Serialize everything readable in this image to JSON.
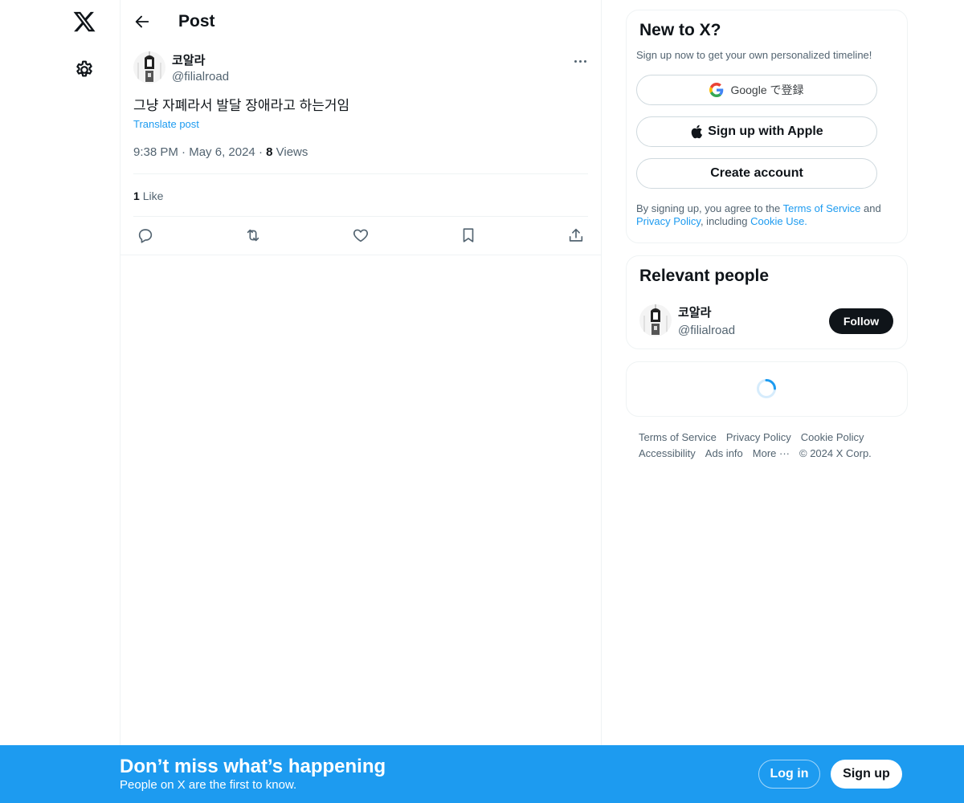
{
  "header": {
    "title": "Post"
  },
  "post": {
    "author_name": "코알라",
    "author_handle": "@filialroad",
    "text": "그냥 자폐라서 발달 장애라고 하는거임",
    "translate_label": "Translate post",
    "time": "9:38 PM",
    "date": "May 6, 2024",
    "views_count": "8",
    "views_label": "Views",
    "likes_count": "1",
    "likes_label": "Like"
  },
  "signup_card": {
    "title": "New to X?",
    "subtitle": "Sign up now to get your own personalized timeline!",
    "google_label": "Google で登録",
    "apple_label": "Sign up with Apple",
    "create_label": "Create account",
    "legal_prefix": "By signing up, you agree to the ",
    "terms_link": "Terms of Service",
    "legal_and": " and ",
    "privacy_link": "Privacy Policy",
    "legal_including": ", including ",
    "cookie_link": "Cookie Use."
  },
  "relevant": {
    "title": "Relevant people",
    "name": "코알라",
    "handle": "@filialroad",
    "follow_label": "Follow"
  },
  "footer": {
    "terms": "Terms of Service",
    "privacy": "Privacy Policy",
    "cookie": "Cookie Policy",
    "accessibility": "Accessibility",
    "ads": "Ads info",
    "more": "More ···",
    "copyright": "© 2024 X Corp."
  },
  "banner": {
    "title": "Don’t miss what’s happening",
    "subtitle": "People on X are the first to know.",
    "login_label": "Log in",
    "signup_label": "Sign up"
  },
  "icons": {
    "logo": "x-logo-icon",
    "settings": "gear-icon",
    "back": "arrow-left-icon",
    "more": "more-dots-icon",
    "reply": "reply-icon",
    "repost": "repost-icon",
    "like": "heart-icon",
    "bookmark": "bookmark-icon",
    "share": "share-icon",
    "google": "google-icon",
    "apple": "apple-icon",
    "loading": "spinner-icon"
  },
  "colors": {
    "accent": "#1d9bf0",
    "text": "#0f1419",
    "secondary": "#536471",
    "border": "#eff3f4"
  }
}
